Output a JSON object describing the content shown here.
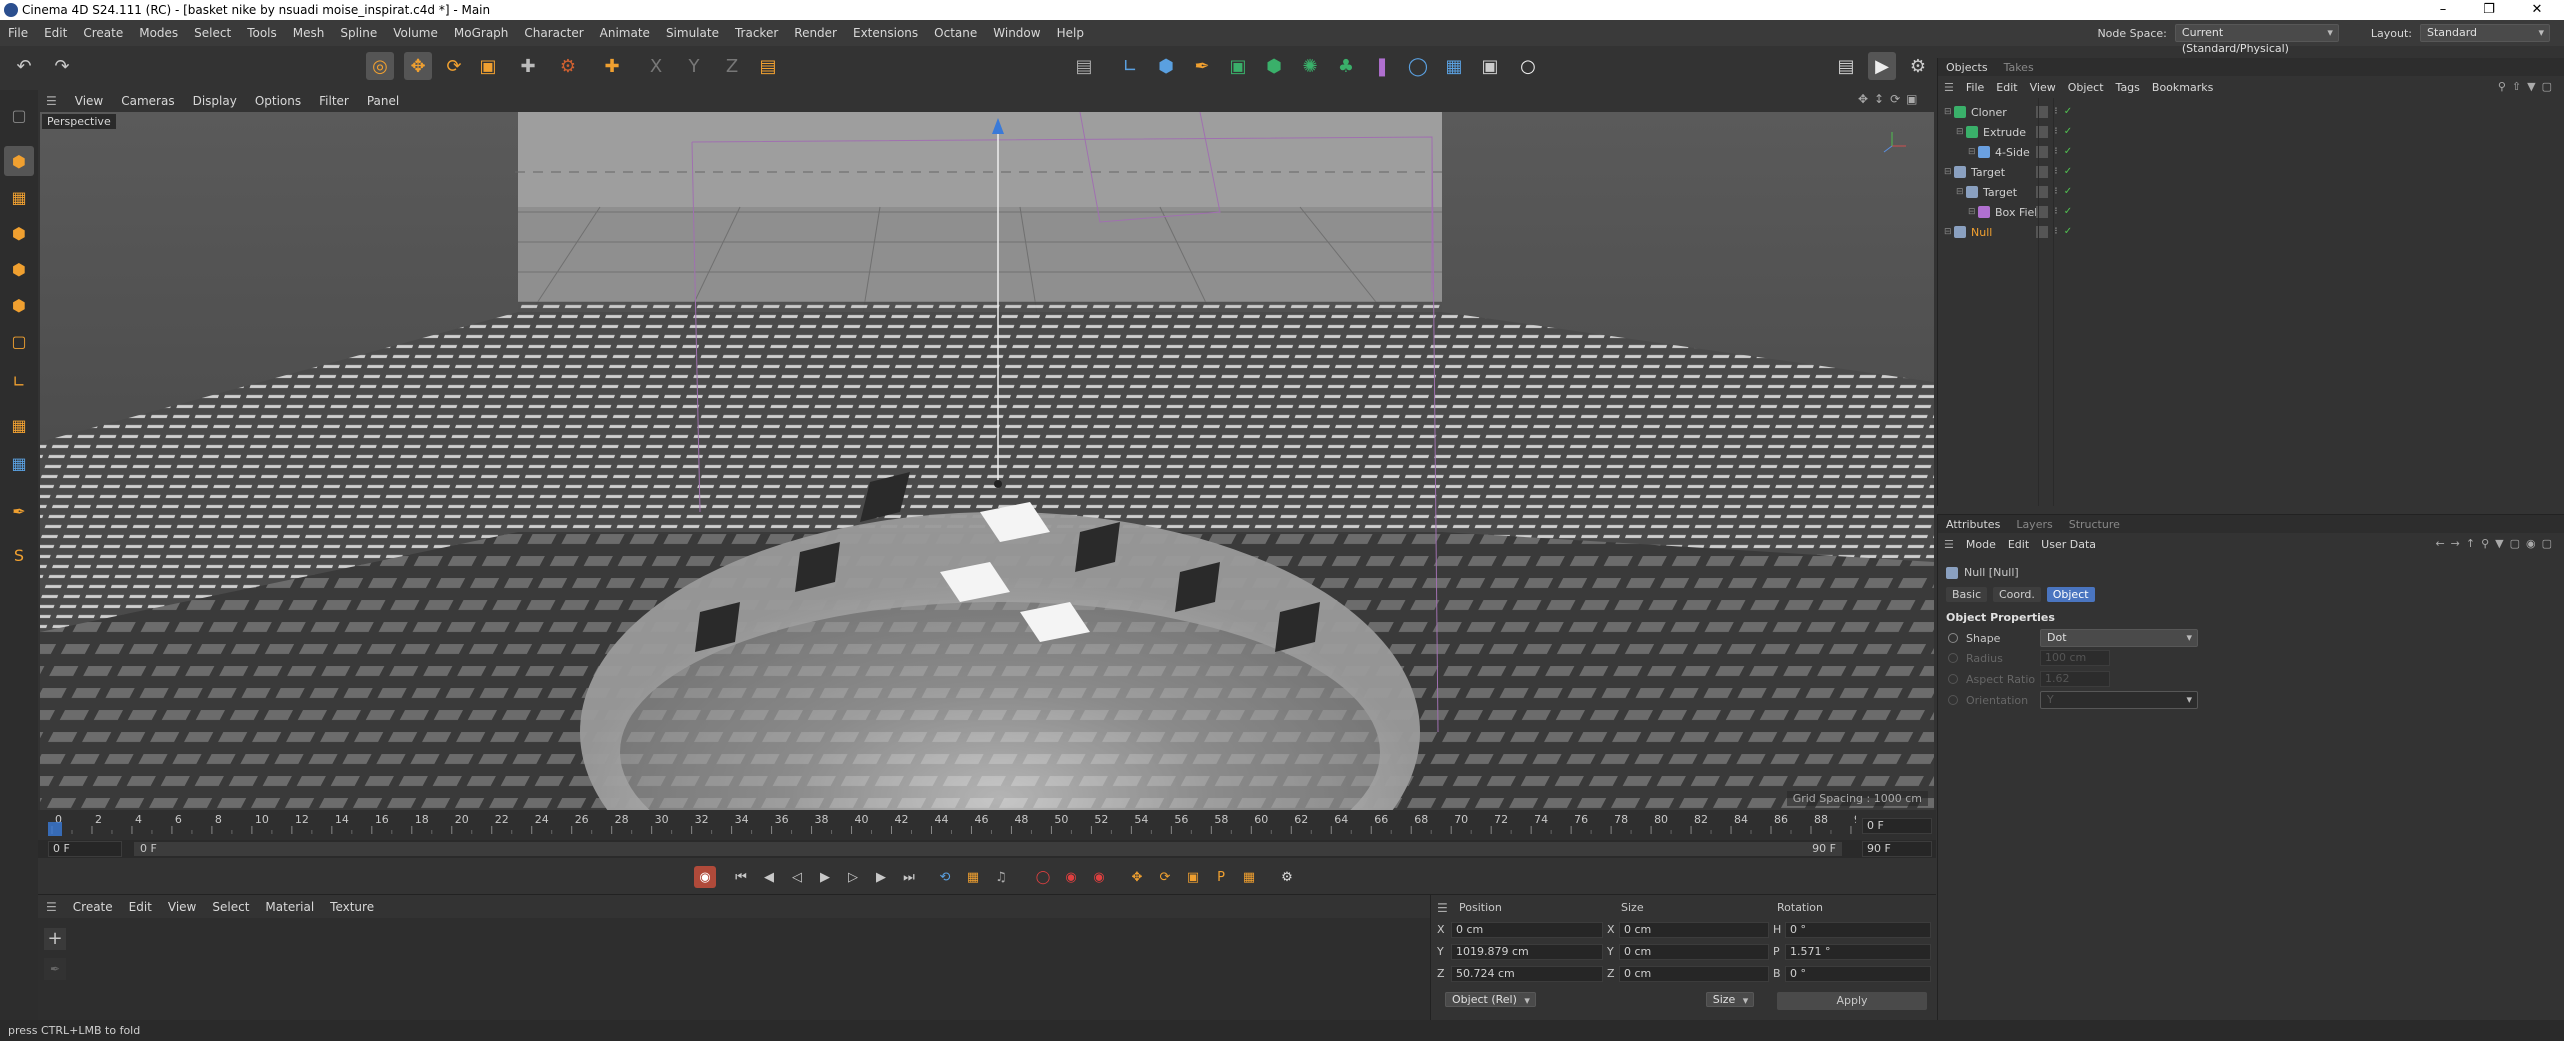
{
  "window": {
    "title": "Cinema 4D S24.111 (RC) - [basket nike by nsuadi moise_inspirat.c4d *] - Main",
    "controls": [
      "minimize-icon",
      "restore-icon",
      "close-icon"
    ]
  },
  "menu": {
    "items": [
      "File",
      "Edit",
      "Create",
      "Modes",
      "Select",
      "Tools",
      "Mesh",
      "Spline",
      "Volume",
      "MoGraph",
      "Character",
      "Animate",
      "Simulate",
      "Tracker",
      "Render",
      "Extensions",
      "Octane",
      "Window",
      "Help"
    ],
    "node_space_label": "Node Space:",
    "node_space_value": "Current (Standard/Physical)",
    "layout_label": "Layout:",
    "layout_value": "Standard"
  },
  "viewport": {
    "menu": [
      "View",
      "Cameras",
      "Display",
      "Options",
      "Filter",
      "Panel"
    ],
    "camera_label": "Perspective",
    "grid_spacing": "Grid Spacing : 1000 cm"
  },
  "timeline": {
    "ticks": [
      "0",
      "2",
      "4",
      "6",
      "8",
      "10",
      "12",
      "14",
      "16",
      "18",
      "20",
      "22",
      "24",
      "26",
      "28",
      "30",
      "32",
      "34",
      "36",
      "38",
      "40",
      "42",
      "44",
      "46",
      "48",
      "50",
      "52",
      "54",
      "56",
      "58",
      "60",
      "62",
      "64",
      "66",
      "68",
      "70",
      "72",
      "74",
      "76",
      "78",
      "80",
      "82",
      "84",
      "86",
      "88",
      "90"
    ],
    "current_frame": "0 F",
    "range_start": "0 F",
    "range_start_inner": "0 F",
    "range_end_inner": "90 F",
    "range_end": "90 F"
  },
  "material_manager": {
    "menu": [
      "Create",
      "Edit",
      "View",
      "Select",
      "Material",
      "Texture"
    ]
  },
  "coordinates": {
    "headers": {
      "position": "Position",
      "size": "Size",
      "rotation": "Rotation"
    },
    "rows": [
      {
        "axis": "X",
        "pos": "0 cm",
        "size_axis": "X",
        "size": "0 cm",
        "rot_axis": "H",
        "rot": "0 °"
      },
      {
        "axis": "Y",
        "pos": "1019.879 cm",
        "size_axis": "Y",
        "size": "0 cm",
        "rot_axis": "P",
        "rot": "1.571 °"
      },
      {
        "axis": "Z",
        "pos": "50.724 cm",
        "size_axis": "Z",
        "size": "0 cm",
        "rot_axis": "B",
        "rot": "0 °"
      }
    ],
    "mode": "Object (Rel)",
    "size_mode": "Size",
    "apply": "Apply"
  },
  "objects_panel": {
    "tabs": [
      "Objects",
      "Takes"
    ],
    "menu": [
      "File",
      "Edit",
      "View",
      "Object",
      "Tags",
      "Bookmarks"
    ],
    "items": [
      {
        "name": "Cloner",
        "indent": 0,
        "color": "#3ab06a",
        "highlight": false
      },
      {
        "name": "Extrude",
        "indent": 1,
        "color": "#3ab06a",
        "highlight": false
      },
      {
        "name": "4-Side",
        "indent": 2,
        "color": "#6aa0e0",
        "highlight": false
      },
      {
        "name": "Target",
        "indent": 0,
        "color": "#8aa0c0",
        "highlight": false
      },
      {
        "name": "Target",
        "indent": 1,
        "color": "#8aa0c0",
        "highlight": false
      },
      {
        "name": "Box Field",
        "indent": 2,
        "color": "#b070d0",
        "highlight": false
      },
      {
        "name": "Null",
        "indent": 0,
        "color": "#8aa0c0",
        "highlight": true
      }
    ]
  },
  "attributes_panel": {
    "tabs": [
      "Attributes",
      "Layers",
      "Structure"
    ],
    "menu": [
      "Mode",
      "Edit",
      "User Data"
    ],
    "object_title": "Null [Null]",
    "sub_tabs": [
      "Basic",
      "Coord.",
      "Object"
    ],
    "active_sub_tab": "Object",
    "section_title": "Object Properties",
    "props": [
      {
        "label": "Shape",
        "value": "Dot",
        "enabled": true
      },
      {
        "label": "Radius",
        "value": "100 cm",
        "enabled": false
      },
      {
        "label": "Aspect Ratio",
        "value": "1.62",
        "enabled": false
      },
      {
        "label": "Orientation",
        "value": "Y",
        "enabled": false
      }
    ]
  },
  "status": {
    "text": "press CTRL+LMB to fold"
  }
}
